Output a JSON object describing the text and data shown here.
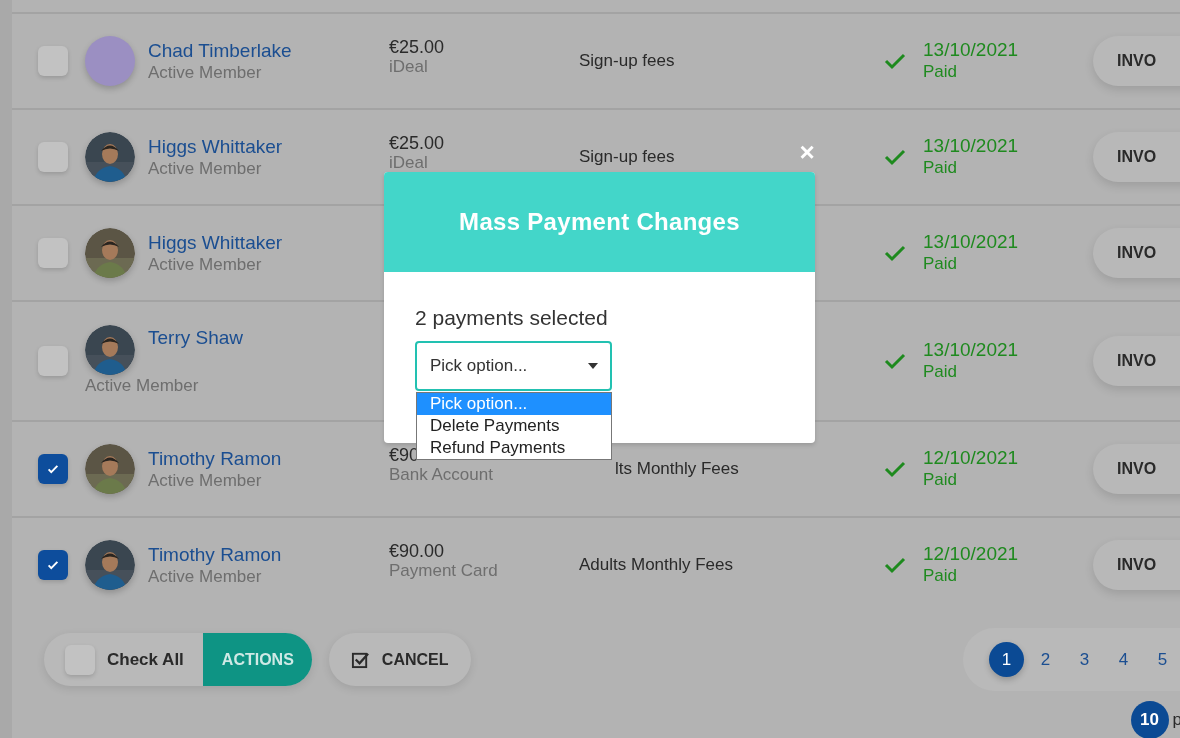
{
  "rows": [
    {
      "kind": "inline",
      "checked": false,
      "avatar": {
        "kind": "plain",
        "color": "#9b8fc2"
      },
      "name": "Chad Timberlake",
      "status": "Active Member",
      "amount": "€25.00",
      "method": "iDeal",
      "description": "Sign-up fees",
      "date": "13/10/2021",
      "payment_status": "Paid",
      "invoice": "INVO"
    },
    {
      "kind": "inline",
      "checked": false,
      "name": "Higgs Whittaker",
      "status": "Active Member",
      "amount": "€25.00",
      "method": "iDeal",
      "description": "Sign-up fees",
      "date": "13/10/2021",
      "payment_status": "Paid",
      "invoice": "INVO"
    },
    {
      "kind": "inline",
      "checked": false,
      "name": "Higgs Whittaker",
      "status": "Active Member",
      "date": "13/10/2021",
      "payment_status": "Paid",
      "invoice": "INVO"
    },
    {
      "kind": "stacked",
      "checked": false,
      "name": "Terry Shaw",
      "status": "Active Member",
      "date": "13/10/2021",
      "payment_status": "Paid",
      "invoice": "INVO"
    },
    {
      "kind": "inline",
      "checked": true,
      "name": "Timothy Ramon",
      "status": "Active Member",
      "amount": "€90",
      "method": "Bank Account",
      "description": "lts Monthly Fees",
      "description_cut": true,
      "date": "12/10/2021",
      "payment_status": "Paid",
      "invoice": "INVO"
    },
    {
      "kind": "inline",
      "checked": true,
      "name": "Timothy Ramon",
      "status": "Active Member",
      "amount": "€90.00",
      "method": "Payment Card",
      "description": "Adults Monthly Fees",
      "date": "12/10/2021",
      "payment_status": "Paid",
      "invoice": "INVO"
    }
  ],
  "footer": {
    "check_all": {
      "label": "Check All",
      "checked": false
    },
    "actions": "ACTIONS",
    "cancel": "CANCEL"
  },
  "pagination": {
    "pages": [
      {
        "label": "1",
        "selected": true
      },
      {
        "label": "2",
        "selected": false
      },
      {
        "label": "3",
        "selected": false
      },
      {
        "label": "4",
        "selected": false
      },
      {
        "label": "5",
        "selected": false
      }
    ],
    "per_page": "10",
    "per_page_label": "p"
  },
  "modal": {
    "close": "×",
    "title": "Mass Payment Changes",
    "summary": "2 payments selected",
    "select": {
      "value": "Pick option...",
      "options": [
        {
          "label": "Pick option...",
          "selected": true
        },
        {
          "label": "Delete Payments",
          "selected": false
        },
        {
          "label": "Refund Payments",
          "selected": false
        }
      ]
    }
  }
}
